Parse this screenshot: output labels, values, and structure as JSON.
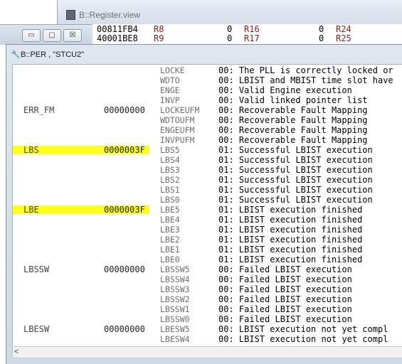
{
  "bg_window": {
    "title": "B::Register.view",
    "controls": [
      "▭",
      "▢",
      "☒"
    ],
    "register_rows": [
      {
        "address": "00811FB4",
        "r1": "R8",
        "v1": "0",
        "r2": "R16",
        "v2": "0",
        "r3": "R24"
      },
      {
        "address": "40001BE8",
        "r1": "R9",
        "v1": "0",
        "r2": "R17",
        "v2": "0",
        "r3": "R25"
      }
    ]
  },
  "per_window": {
    "title_icon": "chip-icon",
    "title": "B::PER , \"STCU2\"",
    "rows": [
      {
        "reg": "",
        "value": "",
        "field": "LOCKE",
        "desc": "00: The PLL is correctly locked or",
        "hl": false
      },
      {
        "reg": "",
        "value": "",
        "field": "WDTO",
        "desc": "00: LBIST and MBIST time slot have",
        "hl": false
      },
      {
        "reg": "",
        "value": "",
        "field": "ENGE",
        "desc": "00: Valid Engine execution",
        "hl": false
      },
      {
        "reg": "",
        "value": "",
        "field": "INVP",
        "desc": "00: Valid linked pointer list",
        "hl": false
      },
      {
        "reg": "ERR_FM",
        "value": "00000000",
        "field": "LOCKEUFM",
        "desc": "00: Recoverable Fault Mapping",
        "hl": false
      },
      {
        "reg": "",
        "value": "",
        "field": "WDTOUFM",
        "desc": "00: Recoverable Fault Mapping",
        "hl": false
      },
      {
        "reg": "",
        "value": "",
        "field": "ENGEUFM",
        "desc": "00: Recoverable Fault Mapping",
        "hl": false
      },
      {
        "reg": "",
        "value": "",
        "field": "INVPUFM",
        "desc": "00: Recoverable Fault Mapping",
        "hl": false
      },
      {
        "reg": "LBS",
        "value": "0000003F",
        "field": "LBS5",
        "desc": "01: Successful LBIST execution",
        "hl": true
      },
      {
        "reg": "",
        "value": "",
        "field": "LBS4",
        "desc": "01: Successful LBIST execution",
        "hl": false
      },
      {
        "reg": "",
        "value": "",
        "field": "LBS3",
        "desc": "01: Successful LBIST execution",
        "hl": false
      },
      {
        "reg": "",
        "value": "",
        "field": "LBS2",
        "desc": "01: Successful LBIST execution",
        "hl": false
      },
      {
        "reg": "",
        "value": "",
        "field": "LBS1",
        "desc": "01: Successful LBIST execution",
        "hl": false
      },
      {
        "reg": "",
        "value": "",
        "field": "LBS0",
        "desc": "01: Successful LBIST execution",
        "hl": false
      },
      {
        "reg": "LBE",
        "value": "0000003F",
        "field": "LBE5",
        "desc": "01: LBIST execution finished",
        "hl": true
      },
      {
        "reg": "",
        "value": "",
        "field": "LBE4",
        "desc": "01: LBIST execution finished",
        "hl": false
      },
      {
        "reg": "",
        "value": "",
        "field": "LBE3",
        "desc": "01: LBIST execution finished",
        "hl": false
      },
      {
        "reg": "",
        "value": "",
        "field": "LBE2",
        "desc": "01: LBIST execution finished",
        "hl": false
      },
      {
        "reg": "",
        "value": "",
        "field": "LBE1",
        "desc": "01: LBIST execution finished",
        "hl": false
      },
      {
        "reg": "",
        "value": "",
        "field": "LBE0",
        "desc": "01: LBIST execution finished",
        "hl": false
      },
      {
        "reg": "LBSSW",
        "value": "00000000",
        "field": "LBSSW5",
        "desc": "00: Failed LBIST execution",
        "hl": false
      },
      {
        "reg": "",
        "value": "",
        "field": "LBSSW4",
        "desc": "00: Failed LBIST execution",
        "hl": false
      },
      {
        "reg": "",
        "value": "",
        "field": "LBSSW3",
        "desc": "00: Failed LBIST execution",
        "hl": false
      },
      {
        "reg": "",
        "value": "",
        "field": "LBSSW2",
        "desc": "00: Failed LBIST execution",
        "hl": false
      },
      {
        "reg": "",
        "value": "",
        "field": "LBSSW1",
        "desc": "00: Failed LBIST execution",
        "hl": false
      },
      {
        "reg": "",
        "value": "",
        "field": "LBSSW0",
        "desc": "00: Failed LBIST execution",
        "hl": false
      },
      {
        "reg": "LBESW",
        "value": "00000000",
        "field": "LBESW5",
        "desc": "00: LBIST execution not yet compl",
        "hl": false
      },
      {
        "reg": "",
        "value": "",
        "field": "LBESW4",
        "desc": "00: LBIST execution not yet compl",
        "hl": false
      }
    ],
    "scroll_left_arrow": "<",
    "highlight_color": "#ffff1c"
  }
}
